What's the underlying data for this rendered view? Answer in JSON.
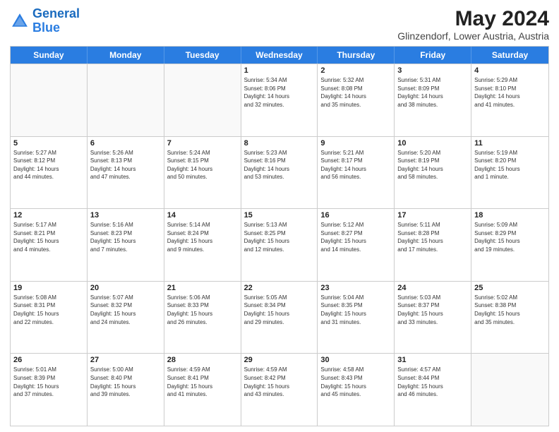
{
  "header": {
    "logo_line1": "General",
    "logo_line2": "Blue",
    "main_title": "May 2024",
    "subtitle": "Glinzendorf, Lower Austria, Austria"
  },
  "days_of_week": [
    "Sunday",
    "Monday",
    "Tuesday",
    "Wednesday",
    "Thursday",
    "Friday",
    "Saturday"
  ],
  "weeks": [
    [
      {
        "day": "",
        "info": "",
        "empty": true
      },
      {
        "day": "",
        "info": "",
        "empty": true
      },
      {
        "day": "",
        "info": "",
        "empty": true
      },
      {
        "day": "1",
        "info": "Sunrise: 5:34 AM\nSunset: 8:06 PM\nDaylight: 14 hours\nand 32 minutes."
      },
      {
        "day": "2",
        "info": "Sunrise: 5:32 AM\nSunset: 8:08 PM\nDaylight: 14 hours\nand 35 minutes."
      },
      {
        "day": "3",
        "info": "Sunrise: 5:31 AM\nSunset: 8:09 PM\nDaylight: 14 hours\nand 38 minutes."
      },
      {
        "day": "4",
        "info": "Sunrise: 5:29 AM\nSunset: 8:10 PM\nDaylight: 14 hours\nand 41 minutes."
      }
    ],
    [
      {
        "day": "5",
        "info": "Sunrise: 5:27 AM\nSunset: 8:12 PM\nDaylight: 14 hours\nand 44 minutes."
      },
      {
        "day": "6",
        "info": "Sunrise: 5:26 AM\nSunset: 8:13 PM\nDaylight: 14 hours\nand 47 minutes."
      },
      {
        "day": "7",
        "info": "Sunrise: 5:24 AM\nSunset: 8:15 PM\nDaylight: 14 hours\nand 50 minutes."
      },
      {
        "day": "8",
        "info": "Sunrise: 5:23 AM\nSunset: 8:16 PM\nDaylight: 14 hours\nand 53 minutes."
      },
      {
        "day": "9",
        "info": "Sunrise: 5:21 AM\nSunset: 8:17 PM\nDaylight: 14 hours\nand 56 minutes."
      },
      {
        "day": "10",
        "info": "Sunrise: 5:20 AM\nSunset: 8:19 PM\nDaylight: 14 hours\nand 58 minutes."
      },
      {
        "day": "11",
        "info": "Sunrise: 5:19 AM\nSunset: 8:20 PM\nDaylight: 15 hours\nand 1 minute."
      }
    ],
    [
      {
        "day": "12",
        "info": "Sunrise: 5:17 AM\nSunset: 8:21 PM\nDaylight: 15 hours\nand 4 minutes."
      },
      {
        "day": "13",
        "info": "Sunrise: 5:16 AM\nSunset: 8:23 PM\nDaylight: 15 hours\nand 7 minutes."
      },
      {
        "day": "14",
        "info": "Sunrise: 5:14 AM\nSunset: 8:24 PM\nDaylight: 15 hours\nand 9 minutes."
      },
      {
        "day": "15",
        "info": "Sunrise: 5:13 AM\nSunset: 8:25 PM\nDaylight: 15 hours\nand 12 minutes."
      },
      {
        "day": "16",
        "info": "Sunrise: 5:12 AM\nSunset: 8:27 PM\nDaylight: 15 hours\nand 14 minutes."
      },
      {
        "day": "17",
        "info": "Sunrise: 5:11 AM\nSunset: 8:28 PM\nDaylight: 15 hours\nand 17 minutes."
      },
      {
        "day": "18",
        "info": "Sunrise: 5:09 AM\nSunset: 8:29 PM\nDaylight: 15 hours\nand 19 minutes."
      }
    ],
    [
      {
        "day": "19",
        "info": "Sunrise: 5:08 AM\nSunset: 8:31 PM\nDaylight: 15 hours\nand 22 minutes."
      },
      {
        "day": "20",
        "info": "Sunrise: 5:07 AM\nSunset: 8:32 PM\nDaylight: 15 hours\nand 24 minutes."
      },
      {
        "day": "21",
        "info": "Sunrise: 5:06 AM\nSunset: 8:33 PM\nDaylight: 15 hours\nand 26 minutes."
      },
      {
        "day": "22",
        "info": "Sunrise: 5:05 AM\nSunset: 8:34 PM\nDaylight: 15 hours\nand 29 minutes."
      },
      {
        "day": "23",
        "info": "Sunrise: 5:04 AM\nSunset: 8:35 PM\nDaylight: 15 hours\nand 31 minutes."
      },
      {
        "day": "24",
        "info": "Sunrise: 5:03 AM\nSunset: 8:37 PM\nDaylight: 15 hours\nand 33 minutes."
      },
      {
        "day": "25",
        "info": "Sunrise: 5:02 AM\nSunset: 8:38 PM\nDaylight: 15 hours\nand 35 minutes."
      }
    ],
    [
      {
        "day": "26",
        "info": "Sunrise: 5:01 AM\nSunset: 8:39 PM\nDaylight: 15 hours\nand 37 minutes."
      },
      {
        "day": "27",
        "info": "Sunrise: 5:00 AM\nSunset: 8:40 PM\nDaylight: 15 hours\nand 39 minutes."
      },
      {
        "day": "28",
        "info": "Sunrise: 4:59 AM\nSunset: 8:41 PM\nDaylight: 15 hours\nand 41 minutes."
      },
      {
        "day": "29",
        "info": "Sunrise: 4:59 AM\nSunset: 8:42 PM\nDaylight: 15 hours\nand 43 minutes."
      },
      {
        "day": "30",
        "info": "Sunrise: 4:58 AM\nSunset: 8:43 PM\nDaylight: 15 hours\nand 45 minutes."
      },
      {
        "day": "31",
        "info": "Sunrise: 4:57 AM\nSunset: 8:44 PM\nDaylight: 15 hours\nand 46 minutes."
      },
      {
        "day": "",
        "info": "",
        "empty": true
      }
    ]
  ]
}
